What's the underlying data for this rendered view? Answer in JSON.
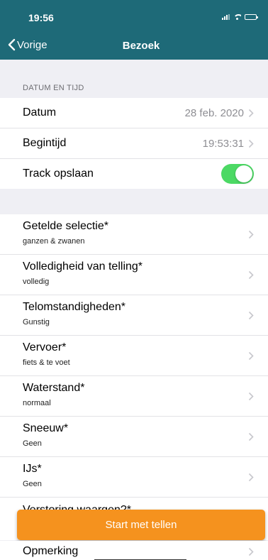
{
  "status_bar": {
    "time": "19:56"
  },
  "nav": {
    "back_label": "Vorige",
    "title": "Bezoek"
  },
  "section": {
    "header": "DATUM EN TIJD"
  },
  "datetime_rows": [
    {
      "label": "Datum",
      "value": "28 feb. 2020"
    },
    {
      "label": "Begintijd",
      "value": "19:53:31"
    }
  ],
  "track": {
    "label": "Track opslaan",
    "enabled": true
  },
  "detail_rows": [
    {
      "label": "Getelde selectie*",
      "sub": "ganzen & zwanen"
    },
    {
      "label": "Volledigheid van telling*",
      "sub": "volledig"
    },
    {
      "label": "Telomstandigheden*",
      "sub": "Gunstig"
    },
    {
      "label": "Vervoer*",
      "sub": "fiets & te voet"
    },
    {
      "label": "Waterstand*",
      "sub": "normaal"
    },
    {
      "label": "Sneeuw*",
      "sub": "Geen"
    },
    {
      "label": "IJs*",
      "sub": "Geen"
    }
  ],
  "partial_row": {
    "label": "Verstoring waargen?*"
  },
  "start_button": {
    "label": "Start met tellen"
  },
  "remark_row": {
    "label": "Opmerking"
  },
  "colors": {
    "brand": "#1e6a78",
    "accent": "#f5921e",
    "toggle_on": "#4cd964"
  }
}
